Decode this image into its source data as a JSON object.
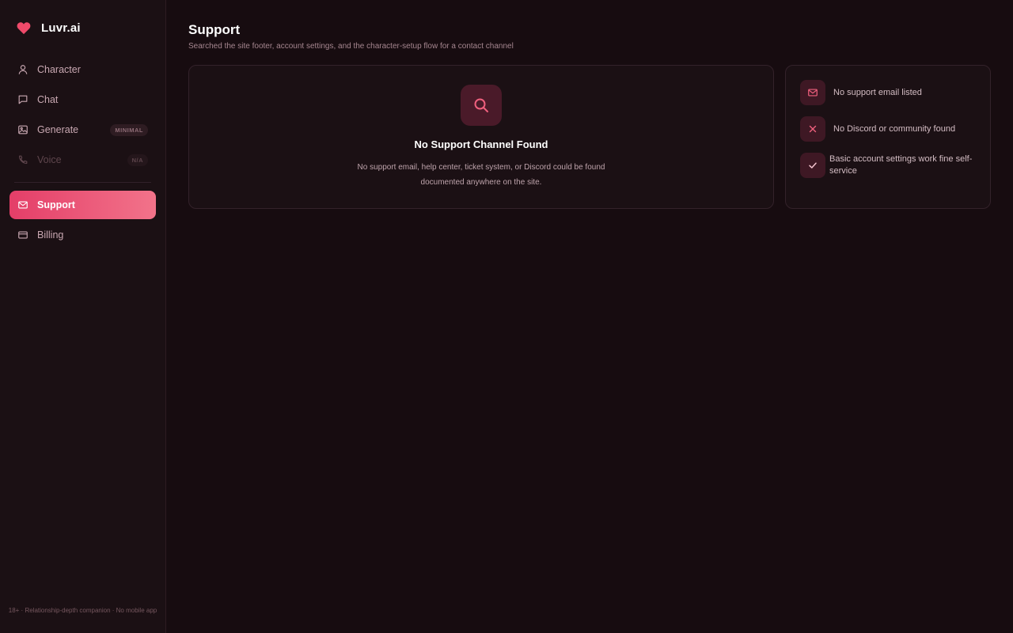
{
  "brand": {
    "name": "Luvr.ai"
  },
  "nav": {
    "character": {
      "label": "Character"
    },
    "chat": {
      "label": "Chat"
    },
    "generate": {
      "label": "Generate",
      "badge": "MINIMAL"
    },
    "voice": {
      "label": "Voice",
      "badge": "N/A"
    },
    "support": {
      "label": "Support"
    },
    "billing": {
      "label": "Billing"
    }
  },
  "sidebar_footer": "18+ · Relationship-depth companion · No mobile app",
  "page": {
    "title": "Support",
    "subtitle": "Searched the site footer, account settings, and the character-setup flow for a contact channel"
  },
  "main_card": {
    "title": "No Support Channel Found",
    "description": "No support email, help center, ticket system, or Discord could be found documented anywhere on the site."
  },
  "side_card": {
    "items": [
      {
        "icon": "mail-icon",
        "text": "No support email listed"
      },
      {
        "icon": "x-icon",
        "text": "No Discord or community found"
      },
      {
        "icon": "check-icon",
        "text": "Basic account settings work fine self-service"
      }
    ]
  },
  "colors": {
    "background": "#170c10",
    "sidebar": "#1b1014",
    "accent": "#e43e68",
    "accent_end": "#f2738a",
    "icon_tile": "#4a1a29"
  }
}
